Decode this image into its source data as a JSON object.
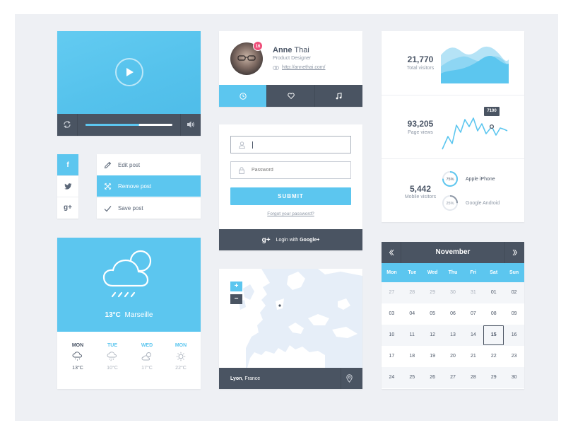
{
  "video": {
    "progress": 0.62
  },
  "profile": {
    "badge": "16",
    "first_name": "Anne",
    "last_name": "Thai",
    "role": "Product Designer",
    "link": "http://annethai.com/",
    "tabs": [
      "clock-icon",
      "heart-icon",
      "music-note-icon"
    ],
    "active_tab": 0
  },
  "stats": {
    "visitors": {
      "value": "21,770",
      "label": "Total visitors"
    },
    "pageviews": {
      "value": "93,205",
      "label": "Page views",
      "tooltip": "7100"
    },
    "mobile": {
      "value": "5,442",
      "label": "Mobile visitors",
      "items": [
        {
          "percent": 75,
          "label_pct": "75%",
          "name": "Apple iPhone",
          "color": "#5cc6ef"
        },
        {
          "percent": 25,
          "label_pct": "25%",
          "name": "Google Android",
          "color": "#8d97a5"
        }
      ]
    }
  },
  "social": [
    "f",
    "t",
    "g+"
  ],
  "menu": {
    "items": [
      {
        "label": "Edit post"
      },
      {
        "label": "Remove post"
      },
      {
        "label": "Save post"
      }
    ]
  },
  "login": {
    "username_placeholder": "",
    "password_placeholder": "Password",
    "submit": "SUBMIT",
    "forgot": "Forgot your password?",
    "google_prefix": "Login with",
    "google_bold": "Google+"
  },
  "weather": {
    "temp": "13°C",
    "city": "Marseille",
    "days": [
      {
        "name": "MON",
        "temp": "13°C"
      },
      {
        "name": "TUE",
        "temp": "10°C"
      },
      {
        "name": "WED",
        "temp": "17°C"
      },
      {
        "name": "MON",
        "temp": "22°C"
      }
    ]
  },
  "map": {
    "zoom_in": "+",
    "zoom_out": "−",
    "city": "Lyon",
    "country": ", France"
  },
  "calendar": {
    "month": "November",
    "dow": [
      "Mon",
      "Tue",
      "Wed",
      "Thu",
      "Fri",
      "Sat",
      "Sun"
    ],
    "weeks": [
      [
        "27",
        "28",
        "29",
        "30",
        "31",
        "01",
        "02"
      ],
      [
        "03",
        "04",
        "05",
        "06",
        "07",
        "08",
        "09"
      ],
      [
        "10",
        "11",
        "12",
        "13",
        "14",
        "15",
        "16"
      ],
      [
        "17",
        "18",
        "19",
        "20",
        "21",
        "22",
        "23"
      ],
      [
        "24",
        "25",
        "26",
        "27",
        "28",
        "29",
        "30"
      ]
    ],
    "selected": "15"
  },
  "colors": {
    "accent": "#5cc6ef",
    "dark": "#4a5462",
    "badge": "#ef4f7a"
  }
}
